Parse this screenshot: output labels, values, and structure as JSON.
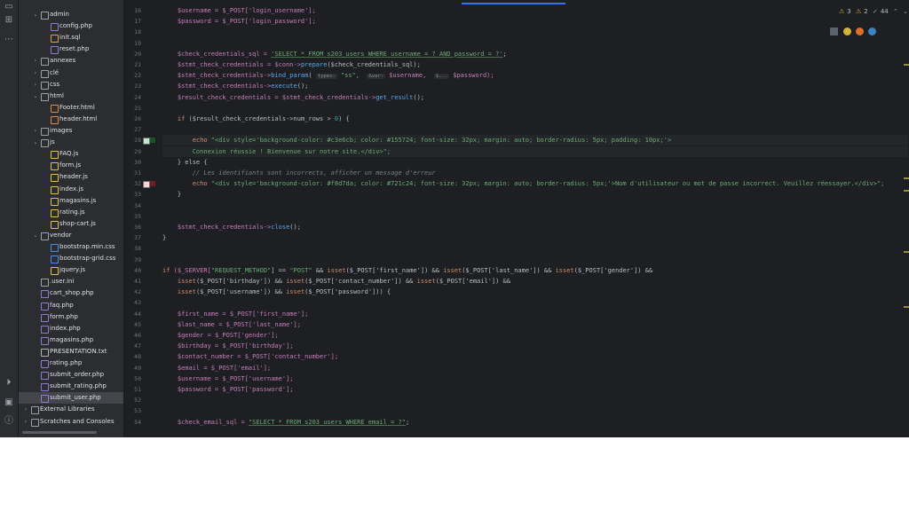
{
  "tree": [
    {
      "label": "admin",
      "indent": 1,
      "type": "folder",
      "open": true
    },
    {
      "label": "config.php",
      "indent": 2,
      "type": "php"
    },
    {
      "label": "init.sql",
      "indent": 2,
      "type": "sql"
    },
    {
      "label": "reset.php",
      "indent": 2,
      "type": "php"
    },
    {
      "label": "annexes",
      "indent": 1,
      "type": "folder",
      "open": false
    },
    {
      "label": "clé",
      "indent": 1,
      "type": "folder",
      "open": false
    },
    {
      "label": "css",
      "indent": 1,
      "type": "folder",
      "open": false
    },
    {
      "label": "html",
      "indent": 1,
      "type": "folder",
      "open": true
    },
    {
      "label": "Footer.html",
      "indent": 2,
      "type": "html"
    },
    {
      "label": "header.html",
      "indent": 2,
      "type": "html"
    },
    {
      "label": "images",
      "indent": 1,
      "type": "folder",
      "open": false
    },
    {
      "label": "js",
      "indent": 1,
      "type": "folder",
      "open": true
    },
    {
      "label": "FAQ.js",
      "indent": 2,
      "type": "js"
    },
    {
      "label": "form.js",
      "indent": 2,
      "type": "js"
    },
    {
      "label": "header.js",
      "indent": 2,
      "type": "js"
    },
    {
      "label": "index.js",
      "indent": 2,
      "type": "js"
    },
    {
      "label": "magasins.js",
      "indent": 2,
      "type": "js"
    },
    {
      "label": "rating.js",
      "indent": 2,
      "type": "js"
    },
    {
      "label": "shop-cart.js",
      "indent": 2,
      "type": "js"
    },
    {
      "label": "vendor",
      "indent": 1,
      "type": "folder",
      "open": true
    },
    {
      "label": "bootstrap.min.css",
      "indent": 2,
      "type": "css"
    },
    {
      "label": "bootstrap-grid.css",
      "indent": 2,
      "type": "css"
    },
    {
      "label": "jquery.js",
      "indent": 2,
      "type": "js"
    },
    {
      "label": ".user.ini",
      "indent": 1,
      "type": "ini"
    },
    {
      "label": "cart_shop.php",
      "indent": 1,
      "type": "php"
    },
    {
      "label": "faq.php",
      "indent": 1,
      "type": "php"
    },
    {
      "label": "form.php",
      "indent": 1,
      "type": "php"
    },
    {
      "label": "index.php",
      "indent": 1,
      "type": "php"
    },
    {
      "label": "magasins.php",
      "indent": 1,
      "type": "php"
    },
    {
      "label": "PRESENTATION.txt",
      "indent": 1,
      "type": "txt"
    },
    {
      "label": "rating.php",
      "indent": 1,
      "type": "php"
    },
    {
      "label": "submit_order.php",
      "indent": 1,
      "type": "php"
    },
    {
      "label": "submit_rating.php",
      "indent": 1,
      "type": "php"
    },
    {
      "label": "submit_user.php",
      "indent": 1,
      "type": "php",
      "selected": true
    },
    {
      "label": "External Libraries",
      "indent": 0,
      "type": "lib",
      "collapsed": true
    },
    {
      "label": "Scratches and Consoles",
      "indent": 0,
      "type": "scratch",
      "collapsed": true
    }
  ],
  "status": {
    "warnings": "3",
    "errors": "2",
    "checks": "44"
  },
  "line_numbers": [
    "16",
    "17",
    "18",
    "19",
    "20",
    "21",
    "22",
    "23",
    "24",
    "25",
    "26",
    "27",
    "28",
    "29",
    "30",
    "31",
    "32",
    "33",
    "34",
    "35",
    "36",
    "37",
    "38",
    "39",
    "40",
    "41",
    "42",
    "43",
    "44",
    "45",
    "46",
    "47",
    "48",
    "49",
    "50",
    "51",
    "52",
    "53",
    "54"
  ],
  "code": [
    [
      [
        "    $username = $_POST['login_username'];",
        "v"
      ]
    ],
    [
      [
        "    $password = $_POST['login_password'];",
        "v"
      ]
    ],
    [],
    [],
    [
      [
        "    $check_credentials_sql = ",
        "v"
      ],
      [
        "'SELECT * FROM s203_users WHERE username = ? AND password = ?'",
        "sq"
      ],
      [
        ";",
        ""
      ]
    ],
    [
      [
        "    $stmt_check_credentials = $conn->",
        "v"
      ],
      [
        "prepare",
        "f"
      ],
      [
        "($check_credentials_sql);",
        ""
      ]
    ],
    [
      [
        "    $stmt_check_credentials->",
        "v"
      ],
      [
        "bind_param",
        "f"
      ],
      [
        "( ",
        ""
      ],
      [
        "types:",
        "hint"
      ],
      [
        " \"ss\",  ",
        "s"
      ],
      [
        "&var:",
        "hint"
      ],
      [
        " $username,  ",
        "v"
      ],
      [
        "$...",
        "hint"
      ],
      [
        " $password);",
        "v"
      ]
    ],
    [
      [
        "    $stmt_check_credentials->",
        "v"
      ],
      [
        "execute",
        "f"
      ],
      [
        "();",
        ""
      ]
    ],
    [
      [
        "    $result_check_credentials = $stmt_check_credentials->",
        "v"
      ],
      [
        "get_result",
        "f"
      ],
      [
        "();",
        ""
      ]
    ],
    [],
    [
      [
        "    if ",
        "k"
      ],
      [
        "($result_check_credentials->num_rows > ",
        ""
      ],
      [
        "0",
        "n"
      ],
      [
        ") {",
        ""
      ]
    ],
    [],
    [
      [
        "        echo ",
        "k"
      ],
      [
        "\"<div style='background-color: #c3e6cb; color: #155724; font-size: 32px; margin: auto; border-radius: 5px; padding: 10px;'>",
        "s"
      ]
    ],
    [
      [
        "        Connexion réussie ! Bienvenue sur notre site.</div>\";",
        "s"
      ]
    ],
    [
      [
        "    } else {",
        ""
      ]
    ],
    [
      [
        "        // Les identifiants sont incorrects, afficher un message d'erreur",
        "c"
      ]
    ],
    [
      [
        "        echo ",
        "k"
      ],
      [
        "\"<div style='background-color: #f8d7da; color: #721c24; font-size: 32px; margin: auto; border-radius: 5px;'>Nom d'utilisateur ou mot de passe incorrect. Veuillez réessayer.</div>\";",
        "s"
      ]
    ],
    [
      [
        "    }",
        ""
      ]
    ],
    [],
    [],
    [
      [
        "    $stmt_check_credentials->",
        "v"
      ],
      [
        "close",
        "f"
      ],
      [
        "();",
        ""
      ]
    ],
    [
      [
        "}",
        ""
      ]
    ],
    [],
    [],
    [
      [
        "if ",
        "k"
      ],
      [
        "($_SERVER[",
        "v"
      ],
      [
        "\"REQUEST_METHOD\"",
        "s"
      ],
      [
        "] == ",
        ""
      ],
      [
        "\"POST\"",
        "s"
      ],
      [
        " && ",
        ""
      ],
      [
        "isset",
        "k"
      ],
      [
        "($_POST['first_name']) && ",
        ""
      ],
      [
        "isset",
        "k"
      ],
      [
        "($_POST['last_name']) && ",
        ""
      ],
      [
        "isset",
        "k"
      ],
      [
        "($_POST['gender']) &&",
        ""
      ]
    ],
    [
      [
        "    isset",
        "k"
      ],
      [
        "($_POST['birthday']) && ",
        ""
      ],
      [
        "isset",
        "k"
      ],
      [
        "($_POST['contact_number']) && ",
        ""
      ],
      [
        "isset",
        "k"
      ],
      [
        "($_POST['email']) &&",
        ""
      ]
    ],
    [
      [
        "    isset",
        "k"
      ],
      [
        "($_POST['username']) && ",
        ""
      ],
      [
        "isset",
        "k"
      ],
      [
        "($_POST['password'])) {",
        ""
      ]
    ],
    [],
    [
      [
        "    $first_name = $_POST['first_name'];",
        "v"
      ]
    ],
    [
      [
        "    $last_name = $_POST['last_name'];",
        "v"
      ]
    ],
    [
      [
        "    $gender = $_POST['gender'];",
        "v"
      ]
    ],
    [
      [
        "    $birthday = $_POST['birthday'];",
        "v"
      ]
    ],
    [
      [
        "    $contact_number = $_POST['contact_number'];",
        "v"
      ]
    ],
    [
      [
        "    $email = $_POST['email'];",
        "v"
      ]
    ],
    [
      [
        "    $username = $_POST['username'];",
        "v"
      ]
    ],
    [
      [
        "    $password = $_POST['password'];",
        "v"
      ]
    ],
    [],
    [],
    [
      [
        "    $check_email_sql = ",
        "v"
      ],
      [
        "\"SELECT * FROM s203_users WHERE email = ?\"",
        "sq"
      ],
      [
        ";",
        ""
      ]
    ]
  ],
  "colors": {
    "swatch_green_bg": "#c3e6cb",
    "swatch_green_fg": "#155724",
    "swatch_red_bg": "#f8d7da",
    "swatch_red_fg": "#721c24",
    "accent": "#3574f0"
  }
}
